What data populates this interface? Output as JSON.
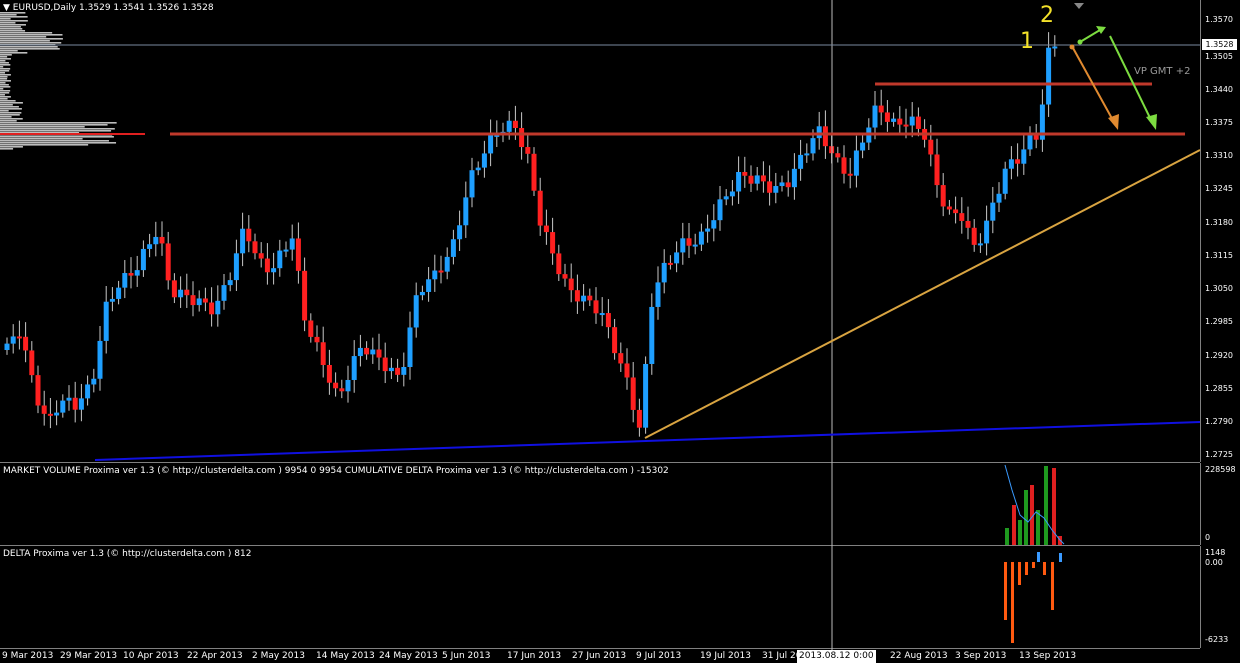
{
  "main_chart": {
    "title": "EURUSD,Daily  1.3529 1.3541 1.3526 1.3528",
    "current_price_label": "1.3528",
    "vp_label": "VP GMT +2",
    "annotations": [
      "1",
      "2"
    ],
    "price_ticks": [
      "1.3570",
      "1.3505",
      "1.3440",
      "1.3375",
      "1.3310",
      "1.3245",
      "1.3180",
      "1.3115",
      "1.3050",
      "1.2985",
      "1.2920",
      "1.2855",
      "1.2790",
      "1.2725"
    ]
  },
  "volume_panel": {
    "title": "MARKET VOLUME Proxima ver 1.3 (© http://clusterdelta.com ) 9954 0 9954  CUMULATIVE DELTA Proxima ver 1.3 (© http://clusterdelta.com ) -15302",
    "ticks": [
      "228598",
      "0"
    ]
  },
  "delta_panel": {
    "title": "DELTA Proxima ver 1.3 (© http://clusterdelta.com ) 812",
    "ticks": [
      "1148",
      "0.00",
      "-6233"
    ]
  },
  "crosshair_date": "2013.08.12 0:00",
  "date_labels": [
    "9 Mar 2013",
    "29 Mar 2013",
    "10 Apr 2013",
    "22 Apr 2013",
    "2 May 2013",
    "14 May 2013",
    "24 May 2013",
    "5 Jun 2013",
    "17 Jun 2013",
    "27 Jun 2013",
    "9 Jul 2013",
    "19 Jul 2013",
    "31 Jul 2013",
    "",
    "22 Aug 2013",
    "3 Sep 2013",
    "13 Sep 2013"
  ],
  "colors": {
    "bull": "#1e9fff",
    "bear": "#ff2020",
    "level_line": "#c0392b",
    "trendline": "#d9a441",
    "blue_line": "#1010e0",
    "volume_green": "#1f9a1f",
    "volume_red": "#e02020",
    "delta_orange": "#ff5a10",
    "delta_blue": "#3a9aff"
  }
}
